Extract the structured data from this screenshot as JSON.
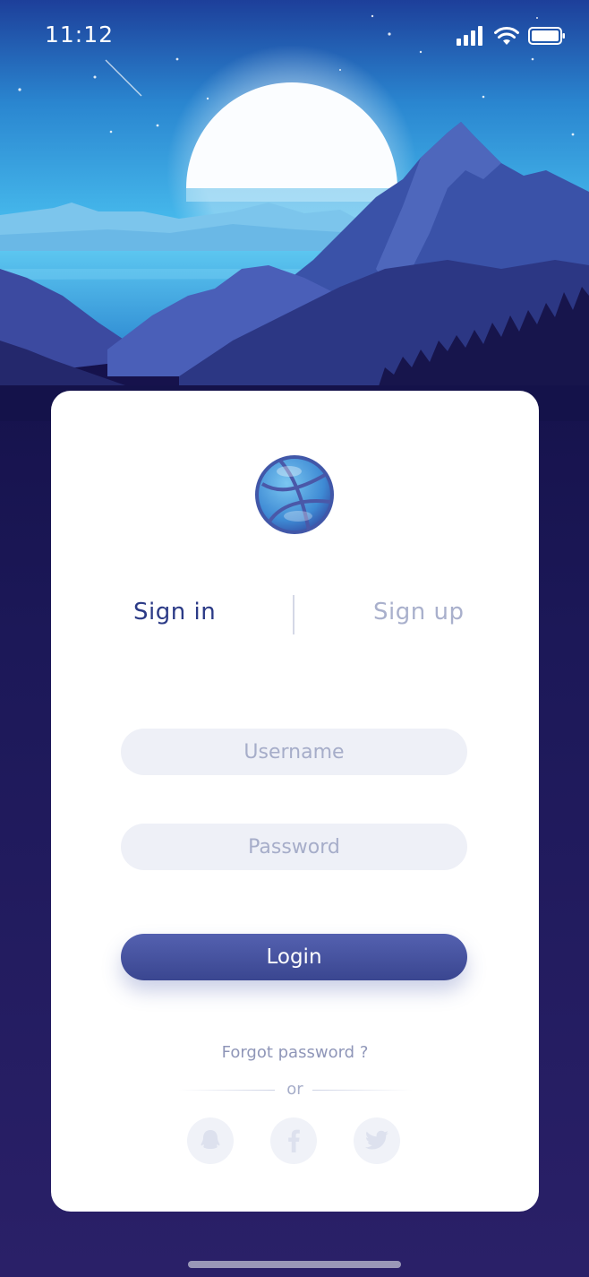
{
  "status_bar": {
    "time": "11:12",
    "icons": [
      "signal-icon",
      "wifi-icon",
      "battery-icon"
    ]
  },
  "card": {
    "logo_icon": "dribbble-logo-icon",
    "tabs": [
      {
        "label": "Sign in",
        "active": true
      },
      {
        "label": "Sign up",
        "active": false
      }
    ],
    "username": {
      "placeholder": "Username",
      "value": ""
    },
    "password": {
      "placeholder": "Password",
      "value": ""
    },
    "login_label": "Login",
    "forgot_label": "Forgot password ?",
    "or_label": "or",
    "social": [
      {
        "icon": "qq-icon"
      },
      {
        "icon": "facebook-icon"
      },
      {
        "icon": "twitter-icon"
      }
    ]
  },
  "colors": {
    "accent": "#2b3a86",
    "button": "#4552a0",
    "inactive": "#a9b0cc",
    "field_bg": "#eef0f7",
    "page_bg": "#1a1650"
  }
}
